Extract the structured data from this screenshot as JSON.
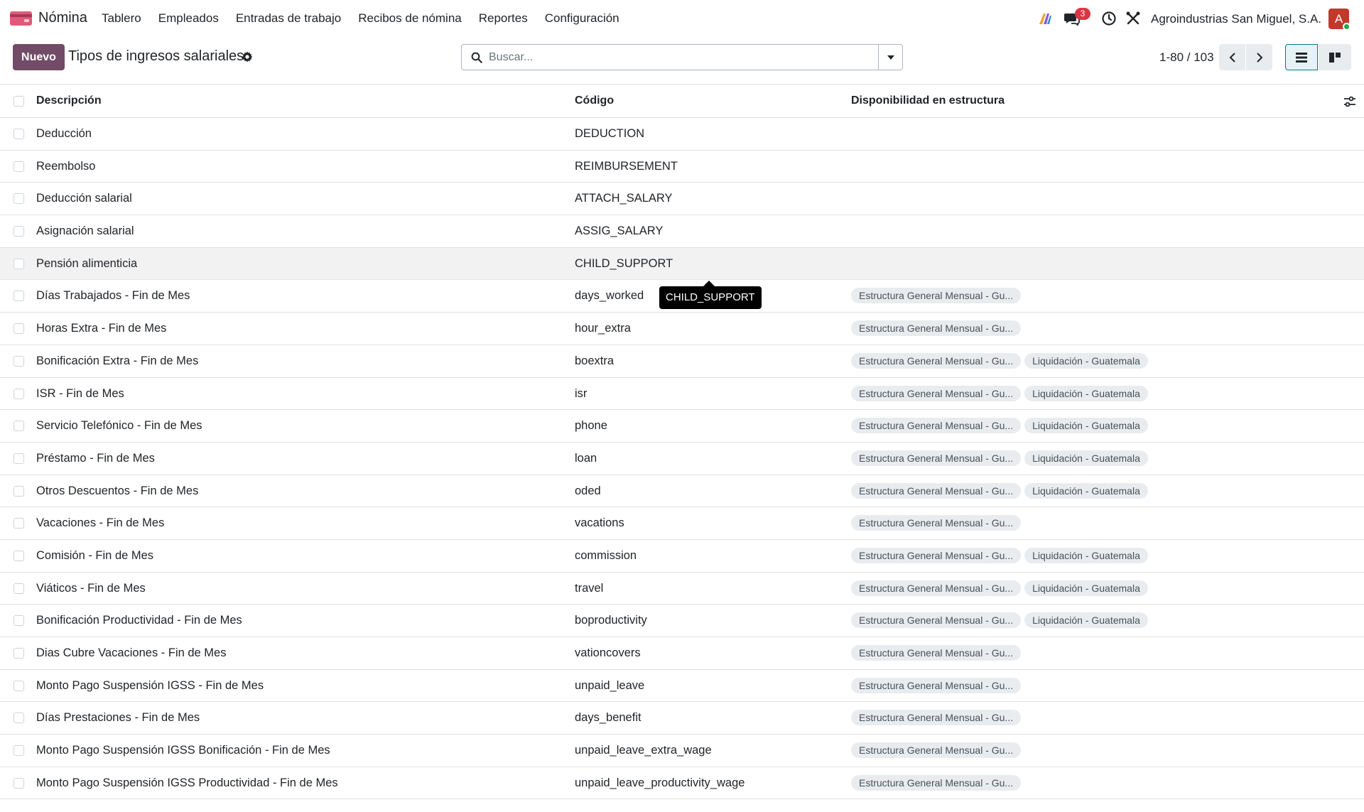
{
  "navbar": {
    "app_name": "Nómina",
    "menu": [
      "Tablero",
      "Empleados",
      "Entradas de trabajo",
      "Recibos de nómina",
      "Reportes",
      "Configuración"
    ],
    "messages_count": "3",
    "company": "Agroindustrias San Miguel, S.A.",
    "avatar_letter": "A",
    "brand_color": "#714b67"
  },
  "control": {
    "new_label": "Nuevo",
    "title": "Tipos de ingresos salariales",
    "search_placeholder": "Buscar...",
    "pager": "1-80 / 103"
  },
  "table": {
    "headers": {
      "description": "Descripción",
      "code": "Código",
      "structure": "Disponibilidad en estructura"
    },
    "rows": [
      {
        "desc": "Deducción",
        "code": "DEDUCTION",
        "tags": []
      },
      {
        "desc": "Reembolso",
        "code": "REIMBURSEMENT",
        "tags": []
      },
      {
        "desc": "Deducción salarial",
        "code": "ATTACH_SALARY",
        "tags": []
      },
      {
        "desc": "Asignación salarial",
        "code": "ASSIG_SALARY",
        "tags": []
      },
      {
        "desc": "Pensión alimenticia",
        "code": "CHILD_SUPPORT",
        "tags": []
      },
      {
        "desc": "Días Trabajados - Fin de Mes",
        "code": "days_worked",
        "tags": [
          "Estructura General Mensual - Gu..."
        ]
      },
      {
        "desc": "Horas Extra - Fin de Mes",
        "code": "hour_extra",
        "tags": [
          "Estructura General Mensual - Gu..."
        ]
      },
      {
        "desc": "Bonificación Extra - Fin de Mes",
        "code": "boextra",
        "tags": [
          "Estructura General Mensual - Gu...",
          "Liquidación - Guatemala"
        ]
      },
      {
        "desc": "ISR - Fin de Mes",
        "code": "isr",
        "tags": [
          "Estructura General Mensual - Gu...",
          "Liquidación - Guatemala"
        ]
      },
      {
        "desc": "Servicio Telefónico - Fin de Mes",
        "code": "phone",
        "tags": [
          "Estructura General Mensual - Gu...",
          "Liquidación - Guatemala"
        ]
      },
      {
        "desc": "Préstamo - Fin de Mes",
        "code": "loan",
        "tags": [
          "Estructura General Mensual - Gu...",
          "Liquidación - Guatemala"
        ]
      },
      {
        "desc": "Otros Descuentos - Fin de Mes",
        "code": "oded",
        "tags": [
          "Estructura General Mensual - Gu...",
          "Liquidación - Guatemala"
        ]
      },
      {
        "desc": "Vacaciones - Fin de Mes",
        "code": "vacations",
        "tags": [
          "Estructura General Mensual - Gu..."
        ]
      },
      {
        "desc": "Comisión - Fin de Mes",
        "code": "commission",
        "tags": [
          "Estructura General Mensual - Gu...",
          "Liquidación - Guatemala"
        ]
      },
      {
        "desc": "Viáticos - Fin de Mes",
        "code": "travel",
        "tags": [
          "Estructura General Mensual - Gu...",
          "Liquidación - Guatemala"
        ]
      },
      {
        "desc": "Bonificación Productividad - Fin de Mes",
        "code": "boproductivity",
        "tags": [
          "Estructura General Mensual - Gu...",
          "Liquidación - Guatemala"
        ]
      },
      {
        "desc": "Dias Cubre Vacaciones - Fin de Mes",
        "code": "vationcovers",
        "tags": [
          "Estructura General Mensual - Gu..."
        ]
      },
      {
        "desc": "Monto Pago Suspensión IGSS - Fin de Mes",
        "code": "unpaid_leave",
        "tags": [
          "Estructura General Mensual - Gu..."
        ]
      },
      {
        "desc": "Días Prestaciones - Fin de Mes",
        "code": "days_benefit",
        "tags": [
          "Estructura General Mensual - Gu..."
        ]
      },
      {
        "desc": "Monto Pago Suspensión IGSS Bonificación - Fin de Mes",
        "code": "unpaid_leave_extra_wage",
        "tags": [
          "Estructura General Mensual - Gu..."
        ]
      },
      {
        "desc": "Monto Pago Suspensión IGSS Productividad - Fin de Mes",
        "code": "unpaid_leave_productivity_wage",
        "tags": [
          "Estructura General Mensual - Gu..."
        ]
      }
    ]
  },
  "tooltip": "CHILD_SUPPORT"
}
